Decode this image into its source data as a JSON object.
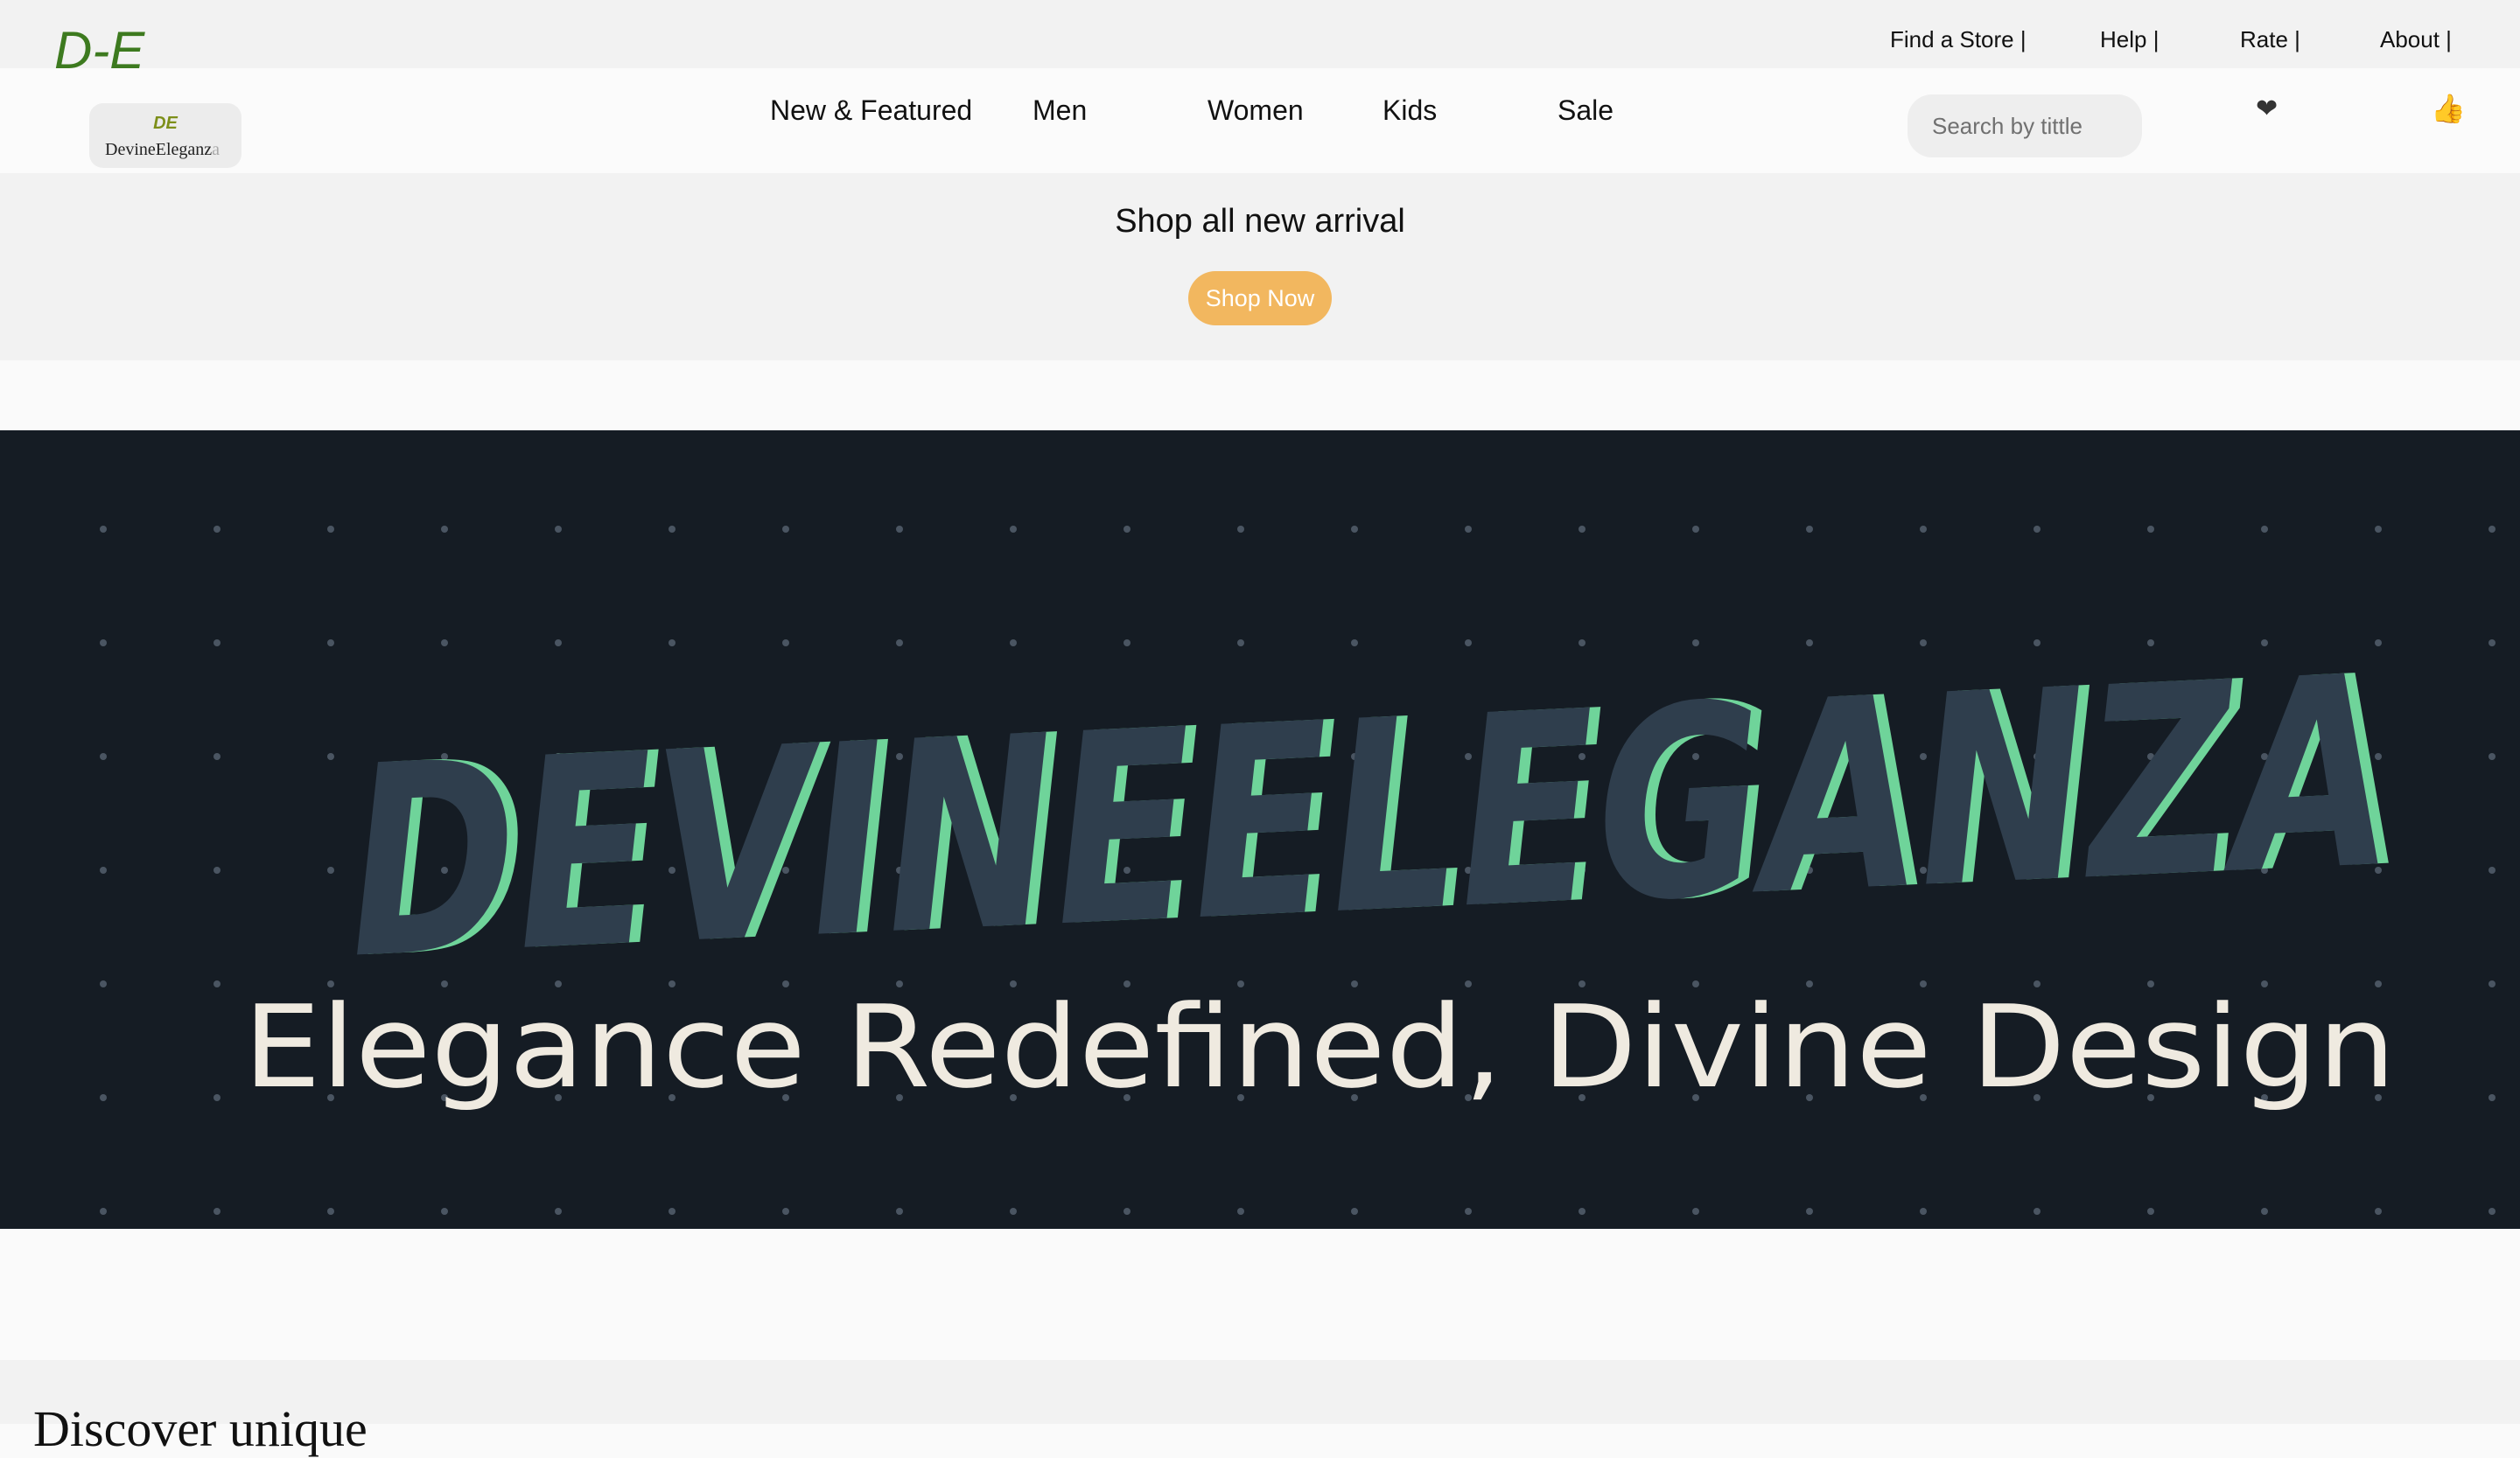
{
  "brand": {
    "short": "D-E",
    "logo_mark": "DE",
    "logo_word_dark": "DevineEleganz",
    "logo_word_light": "a"
  },
  "top_links": [
    {
      "label": "Find a Store |"
    },
    {
      "label": "Help |"
    },
    {
      "label": "Rate |"
    },
    {
      "label": "About |"
    }
  ],
  "nav": [
    {
      "label": "New & Featured"
    },
    {
      "label": "Men"
    },
    {
      "label": "Women"
    },
    {
      "label": "Kids"
    },
    {
      "label": "Sale"
    }
  ],
  "search": {
    "placeholder": "Search by tittle"
  },
  "icons": {
    "wishlist": "❤",
    "like": "👍"
  },
  "promo": {
    "title": "Shop all new arrival",
    "button": "Shop Now"
  },
  "hero": {
    "wordmark": "DEVINEELEGANZA",
    "tagline": "Elegance Redefined, Divine Design",
    "colors": {
      "background": "#151c24",
      "letters": "#2f3e4d",
      "accent": "#6fd49a",
      "tagline": "#efeae0"
    }
  },
  "section": {
    "heading": "Discover unique"
  }
}
